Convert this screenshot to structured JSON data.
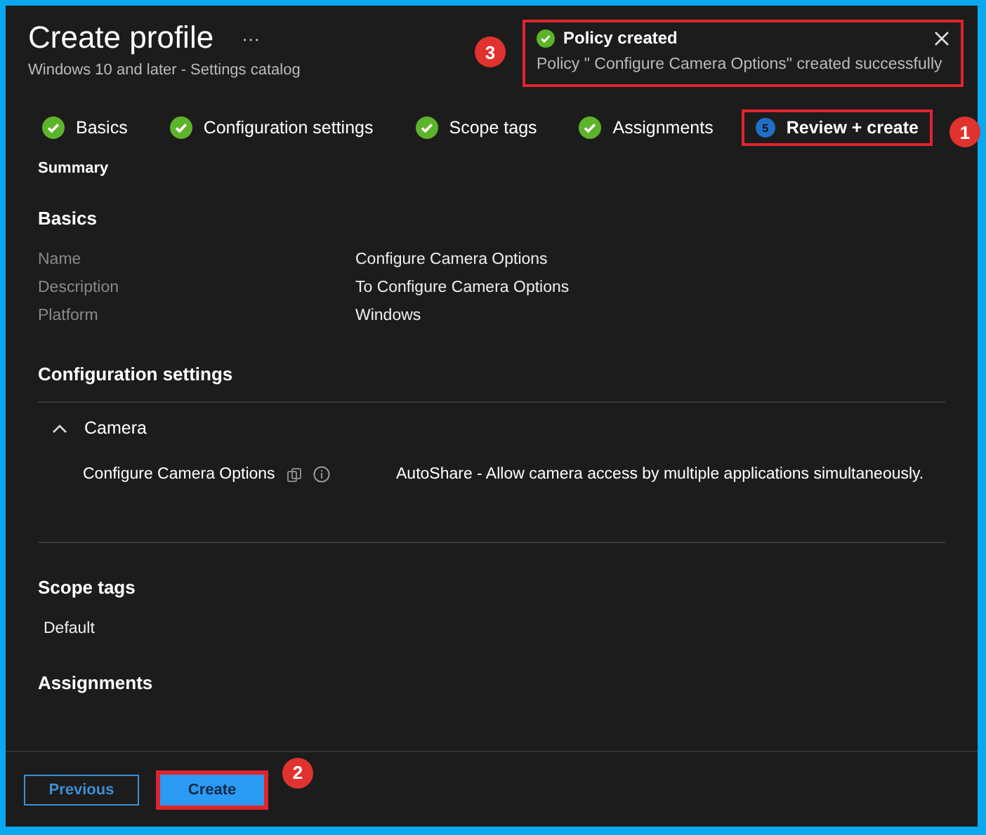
{
  "header": {
    "title": "Create profile",
    "more": "···",
    "subtitle": "Windows 10 and later - Settings catalog"
  },
  "toast": {
    "title": "Policy created",
    "message": "Policy \" Configure Camera Options\" created successfully",
    "highlighted": true,
    "callout": "3"
  },
  "steps": [
    {
      "label": "Basics",
      "kind": "done",
      "selected": false,
      "highlighted": false
    },
    {
      "label": "Configuration settings",
      "kind": "done",
      "selected": false,
      "highlighted": false
    },
    {
      "label": "Scope tags",
      "kind": "done",
      "selected": false,
      "highlighted": false
    },
    {
      "label": "Assignments",
      "kind": "done",
      "selected": false,
      "highlighted": false
    },
    {
      "label": "Review + create",
      "kind": "current",
      "number": "5",
      "selected": true,
      "highlighted": true,
      "callout": "1"
    }
  ],
  "summary_title": "Summary",
  "basics": {
    "heading": "Basics",
    "rows": [
      {
        "label": "Name",
        "value": "Configure Camera Options"
      },
      {
        "label": "Description",
        "value": "To  Configure Camera Options"
      },
      {
        "label": "Platform",
        "value": "Windows"
      }
    ]
  },
  "configuration": {
    "heading": "Configuration settings",
    "group": {
      "name": "Camera",
      "expanded": true,
      "settings": [
        {
          "name": "Configure Camera Options",
          "value": "AutoShare - Allow camera access by multiple applications simultaneously."
        }
      ]
    }
  },
  "scope_tags": {
    "heading": "Scope tags",
    "value": "Default"
  },
  "assignments": {
    "heading": "Assignments"
  },
  "footer": {
    "buttons": [
      {
        "label": "Previous",
        "kind": "secondary",
        "highlighted": false
      },
      {
        "label": "Create",
        "kind": "primary",
        "highlighted": true,
        "callout": "2"
      }
    ]
  }
}
